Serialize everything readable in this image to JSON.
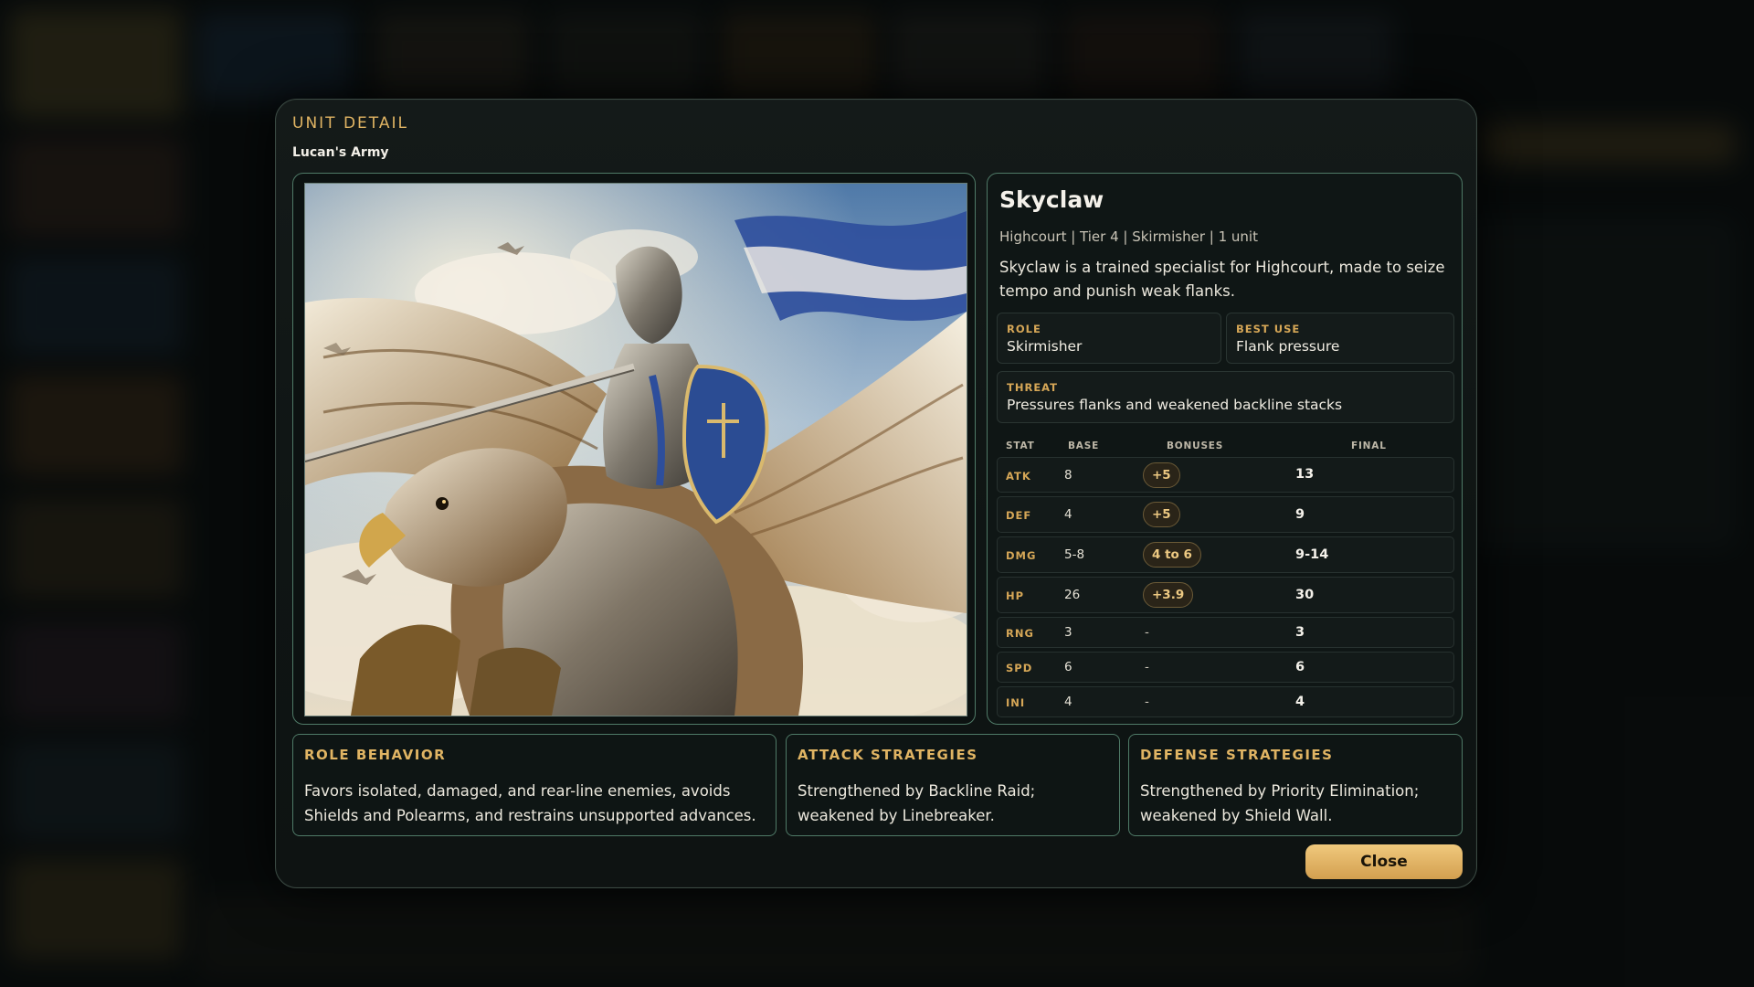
{
  "modal": {
    "kicker": "UNIT DETAIL",
    "army": "Lucan's Army",
    "close_label": "Close"
  },
  "unit": {
    "name": "Skyclaw",
    "subtitle": "Highcourt | Tier 4 | Skirmisher | 1 unit",
    "description": "Skyclaw is a trained specialist for Highcourt, made to seize tempo and punish weak flanks.",
    "role_label": "ROLE",
    "role": "Skirmisher",
    "best_use_label": "BEST USE",
    "best_use": "Flank pressure",
    "threat_label": "THREAT",
    "threat": "Pressures flanks and weakened backline stacks"
  },
  "stats": {
    "headers": [
      "STAT",
      "BASE",
      "BONUSES",
      "FINAL"
    ],
    "rows": [
      {
        "stat": "ATK",
        "base": "8",
        "bonus": "+5",
        "final": "13"
      },
      {
        "stat": "DEF",
        "base": "4",
        "bonus": "+5",
        "final": "9"
      },
      {
        "stat": "DMG",
        "base": "5-8",
        "bonus": "4 to 6",
        "final": "9-14"
      },
      {
        "stat": "HP",
        "base": "26",
        "bonus": "+3.9",
        "final": "30"
      },
      {
        "stat": "RNG",
        "base": "3",
        "bonus": "-",
        "final": "3"
      },
      {
        "stat": "SPD",
        "base": "6",
        "bonus": "-",
        "final": "6"
      },
      {
        "stat": "INI",
        "base": "4",
        "bonus": "-",
        "final": "4"
      }
    ]
  },
  "panels": {
    "role_behavior": {
      "title": "ROLE BEHAVIOR",
      "line1": "Favors isolated, damaged, and rear-line enemies, avoids",
      "line2": "Shields and Polearms, and restrains unsupported advances."
    },
    "attack": {
      "title": "ATTACK STRATEGIES",
      "line1": "Strengthened by Backline Raid;",
      "line2": "weakened by Linebreaker."
    },
    "defense": {
      "title": "DEFENSE STRATEGIES",
      "line1": "Strengthened by Priority Elimination;",
      "line2": "weakened by Shield Wall."
    }
  },
  "art": {
    "subject": "armored knight riding griffin",
    "icon": "unit-portrait"
  },
  "colors": {
    "accent_gold": "#e0b463",
    "frame_teal": "#4f7a67",
    "button_gold": "#e2b468"
  }
}
